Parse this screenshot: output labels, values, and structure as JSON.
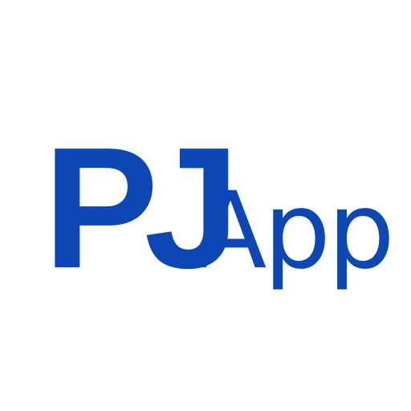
{
  "logo": {
    "mark_text": "PJ",
    "wordmark_text": "App",
    "color": "#0D47B5"
  }
}
